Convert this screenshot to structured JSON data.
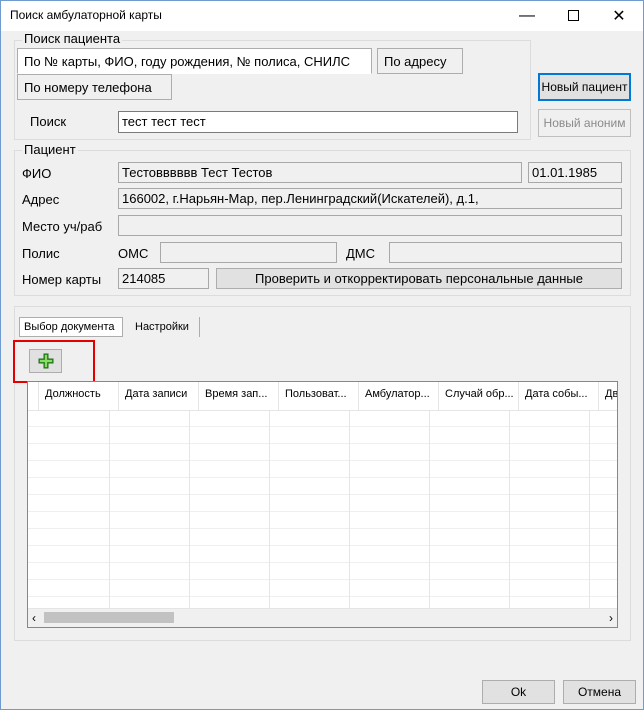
{
  "window": {
    "title": "Поиск амбулаторной карты"
  },
  "search": {
    "legend": "Поиск пациента",
    "tabs": [
      "По № карты, ФИО, году рождения, № полиса, СНИЛС",
      "По адресу",
      "По номеру телефона"
    ],
    "label": "Поиск",
    "value": "тест тест тест",
    "new_patient_label": "Новый пациент",
    "new_anon_label": "Новый аноним"
  },
  "patient": {
    "legend": "Пациент",
    "fio_label": "ФИО",
    "fio_value": "Тестовввввв Тест Тестов",
    "birth_date": "01.01.1985",
    "address_label": "Адрес",
    "address_value": "166002, г.Нарьян-Мар, пер.Ленинградский(Искателей), д.1,",
    "workplace_label": "Место уч/раб",
    "workplace_value": "",
    "policy_label": "Полис",
    "oms_label": "ОМС",
    "oms_value": "",
    "dms_label": "ДМС",
    "dms_value": "",
    "card_label": "Номер карты",
    "card_value": "214085",
    "verify_label": "Проверить и откорректировать персональные данные"
  },
  "documents": {
    "tabs": [
      "Выбор документа",
      "Настройки"
    ],
    "columns": [
      "Должность",
      "Дата записи",
      "Время зап...",
      "Пользоват...",
      "Амбулатор...",
      "Случай обр...",
      "Дата собы...",
      "Движ"
    ]
  },
  "footer": {
    "ok_label": "Ok",
    "cancel_label": "Отмена"
  },
  "colors": {
    "highlight": "#e50000",
    "accent": "#0078d7",
    "plus_green": "#3aa52a"
  }
}
